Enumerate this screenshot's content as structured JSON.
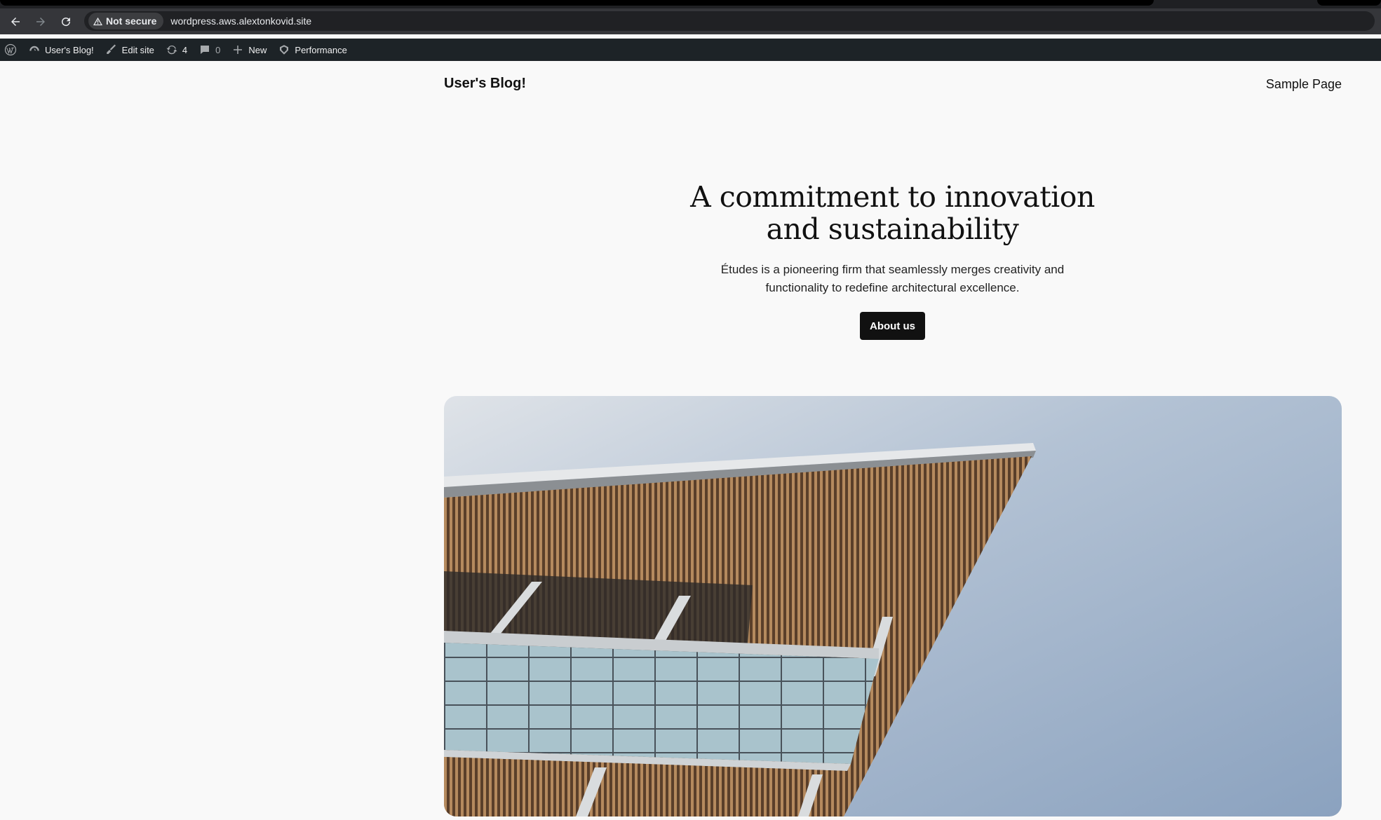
{
  "browser": {
    "security_chip": "Not secure",
    "url": "wordpress.aws.alextonkovid.site"
  },
  "adminbar": {
    "site_name": "User's Blog!",
    "edit_site": "Edit site",
    "updates_count": "4",
    "comments_count": "0",
    "new": "New",
    "performance": "Performance"
  },
  "header": {
    "site_title": "User's Blog!",
    "nav_sample_page": "Sample Page"
  },
  "hero": {
    "heading_line1": "A commitment to innovation",
    "heading_line2": "and sustainability",
    "text_line1": "Études is a pioneering firm that seamlessly merges creativity and",
    "text_line2": "functionality to redefine architectural excellence.",
    "cta_label": "About us"
  },
  "colors": {
    "admin_bar_bg": "#1d2327",
    "page_bg": "#f9f9f9",
    "button_bg": "#111111"
  }
}
